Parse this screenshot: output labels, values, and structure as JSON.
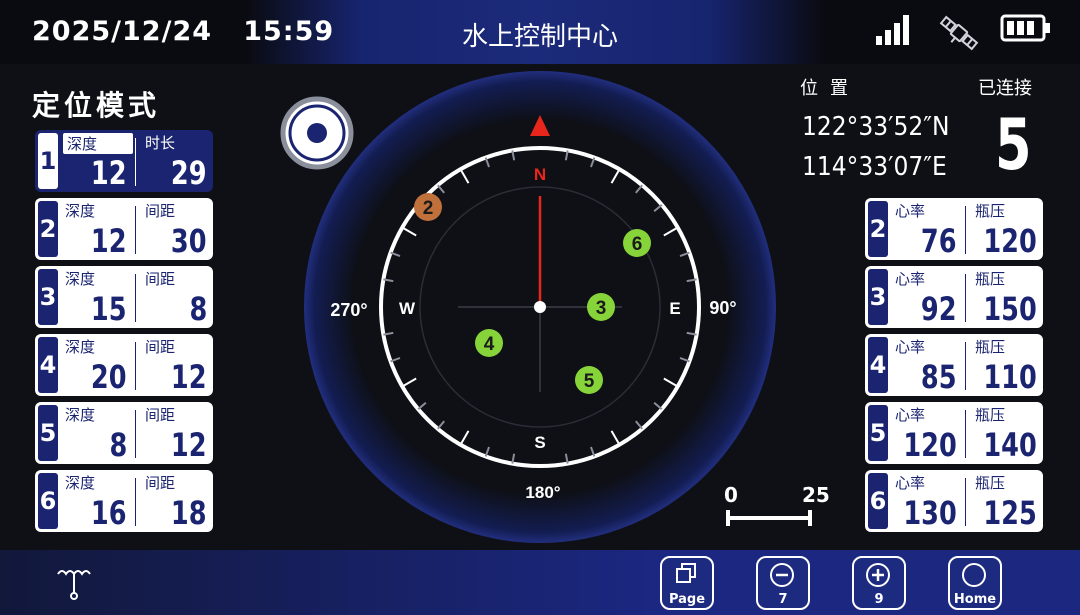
{
  "header": {
    "date": "2025/12/24",
    "time": "15:59",
    "title": "水上控制中心"
  },
  "status_icons": [
    "signal-bars-icon",
    "satellite-icon",
    "battery-icon"
  ],
  "left_panel": {
    "title": "定位模式",
    "cards": [
      {
        "index": "1",
        "label1": "深度",
        "value1": "12",
        "label2": "时长",
        "value2": "29",
        "active": true
      },
      {
        "index": "2",
        "label1": "深度",
        "value1": "12",
        "label2": "间距",
        "value2": "30"
      },
      {
        "index": "3",
        "label1": "深度",
        "value1": "15",
        "label2": "间距",
        "value2": "8"
      },
      {
        "index": "4",
        "label1": "深度",
        "value1": "20",
        "label2": "间距",
        "value2": "12"
      },
      {
        "index": "5",
        "label1": "深度",
        "value1": "8",
        "label2": "间距",
        "value2": "12"
      },
      {
        "index": "6",
        "label1": "深度",
        "value1": "16",
        "label2": "间距",
        "value2": "18"
      }
    ]
  },
  "right_panel": {
    "position_label": "位置",
    "latitude": "122°33′52″N",
    "longitude": "114°33′07″E",
    "connected_label": "已连接",
    "connected_count": "5",
    "cards": [
      {
        "index": "2",
        "label1": "心率",
        "value1": "76",
        "label2": "瓶压",
        "value2": "120"
      },
      {
        "index": "3",
        "label1": "心率",
        "value1": "92",
        "label2": "瓶压",
        "value2": "150"
      },
      {
        "index": "4",
        "label1": "心率",
        "value1": "85",
        "label2": "瓶压",
        "value2": "110"
      },
      {
        "index": "5",
        "label1": "心率",
        "value1": "120",
        "label2": "瓶压",
        "value2": "140"
      },
      {
        "index": "6",
        "label1": "心率",
        "value1": "130",
        "label2": "瓶压",
        "value2": "125"
      }
    ]
  },
  "compass": {
    "north": "N",
    "south": "S",
    "east": "E",
    "west": "W",
    "east_deg": "90°",
    "west_deg": "270°",
    "south_deg": "180°",
    "markers": [
      {
        "label": "2",
        "color": "#c0703a"
      },
      {
        "label": "3",
        "color": "#86d33a"
      },
      {
        "label": "4",
        "color": "#86d33a"
      },
      {
        "label": "5",
        "color": "#86d33a"
      },
      {
        "label": "6",
        "color": "#86d33a"
      }
    ]
  },
  "scale": {
    "min": "0",
    "max": "25"
  },
  "bottom_buttons": [
    {
      "label": "Page",
      "icon": "page-icon"
    },
    {
      "label": "7",
      "icon": "minus-icon"
    },
    {
      "label": "9",
      "icon": "plus-icon"
    },
    {
      "label": "Home",
      "icon": "home-icon"
    }
  ],
  "colors": {
    "accent": "#1b2470",
    "north": "#e8261c",
    "ok_marker": "#86d33a",
    "warn_marker": "#c0703a"
  }
}
